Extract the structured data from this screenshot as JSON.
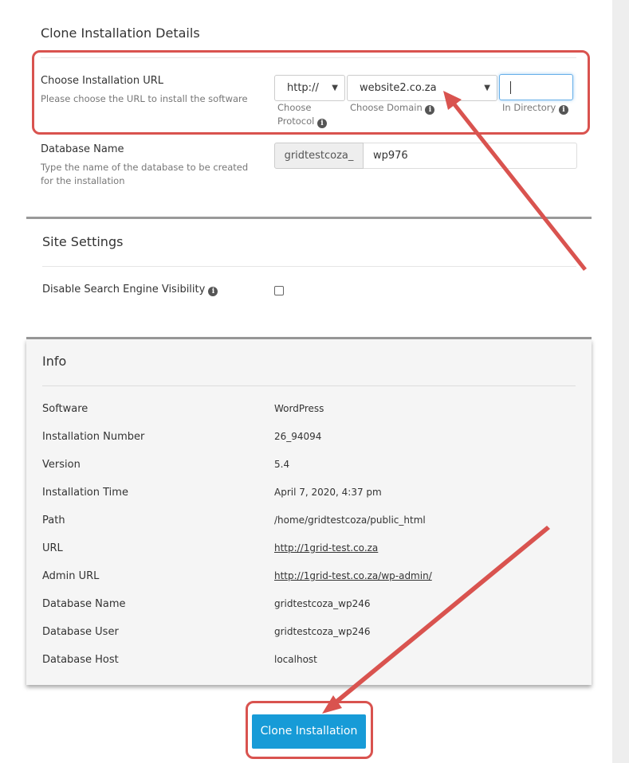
{
  "clone_details": {
    "title": "Clone Installation Details",
    "url_label": "Choose Installation URL",
    "url_sublabel": "Please choose the URL to install the software",
    "protocol_value": "http://",
    "protocol_hint_line1": "Choose",
    "protocol_hint_line2": "Protocol",
    "domain_value": "website2.co.za",
    "domain_hint": "Choose Domain",
    "directory_value": "",
    "directory_hint": "In Directory",
    "db_label": "Database Name",
    "db_sublabel_line1": "Type the name of the database to be created",
    "db_sublabel_line2": "for the installation",
    "db_prefix": "gridtestcoza_",
    "db_value": "wp976"
  },
  "site_settings": {
    "title": "Site Settings",
    "search_visibility_label": "Disable Search Engine Visibility",
    "search_visibility_checked": false
  },
  "info": {
    "title": "Info",
    "rows": [
      {
        "label": "Software",
        "value": "WordPress"
      },
      {
        "label": "Installation Number",
        "value": "26_94094"
      },
      {
        "label": "Version",
        "value": "5.4"
      },
      {
        "label": "Installation Time",
        "value": "April 7, 2020, 4:37 pm"
      },
      {
        "label": "Path",
        "value": "/home/gridtestcoza/public_html"
      },
      {
        "label": "URL",
        "value": "http://1grid-test.co.za"
      },
      {
        "label": "Admin URL",
        "value": "http://1grid-test.co.za/wp-admin/"
      },
      {
        "label": "Database Name",
        "value": "gridtestcoza_wp246"
      },
      {
        "label": "Database User",
        "value": "gridtestcoza_wp246"
      },
      {
        "label": "Database Host",
        "value": "localhost"
      }
    ]
  },
  "actions": {
    "clone_button": "Clone Installation"
  },
  "colors": {
    "accent_button": "#179bd7",
    "annotation_red": "#d9534f"
  },
  "icons": {
    "info": "info-circle-icon",
    "dropdown": "chevron-down-icon"
  }
}
